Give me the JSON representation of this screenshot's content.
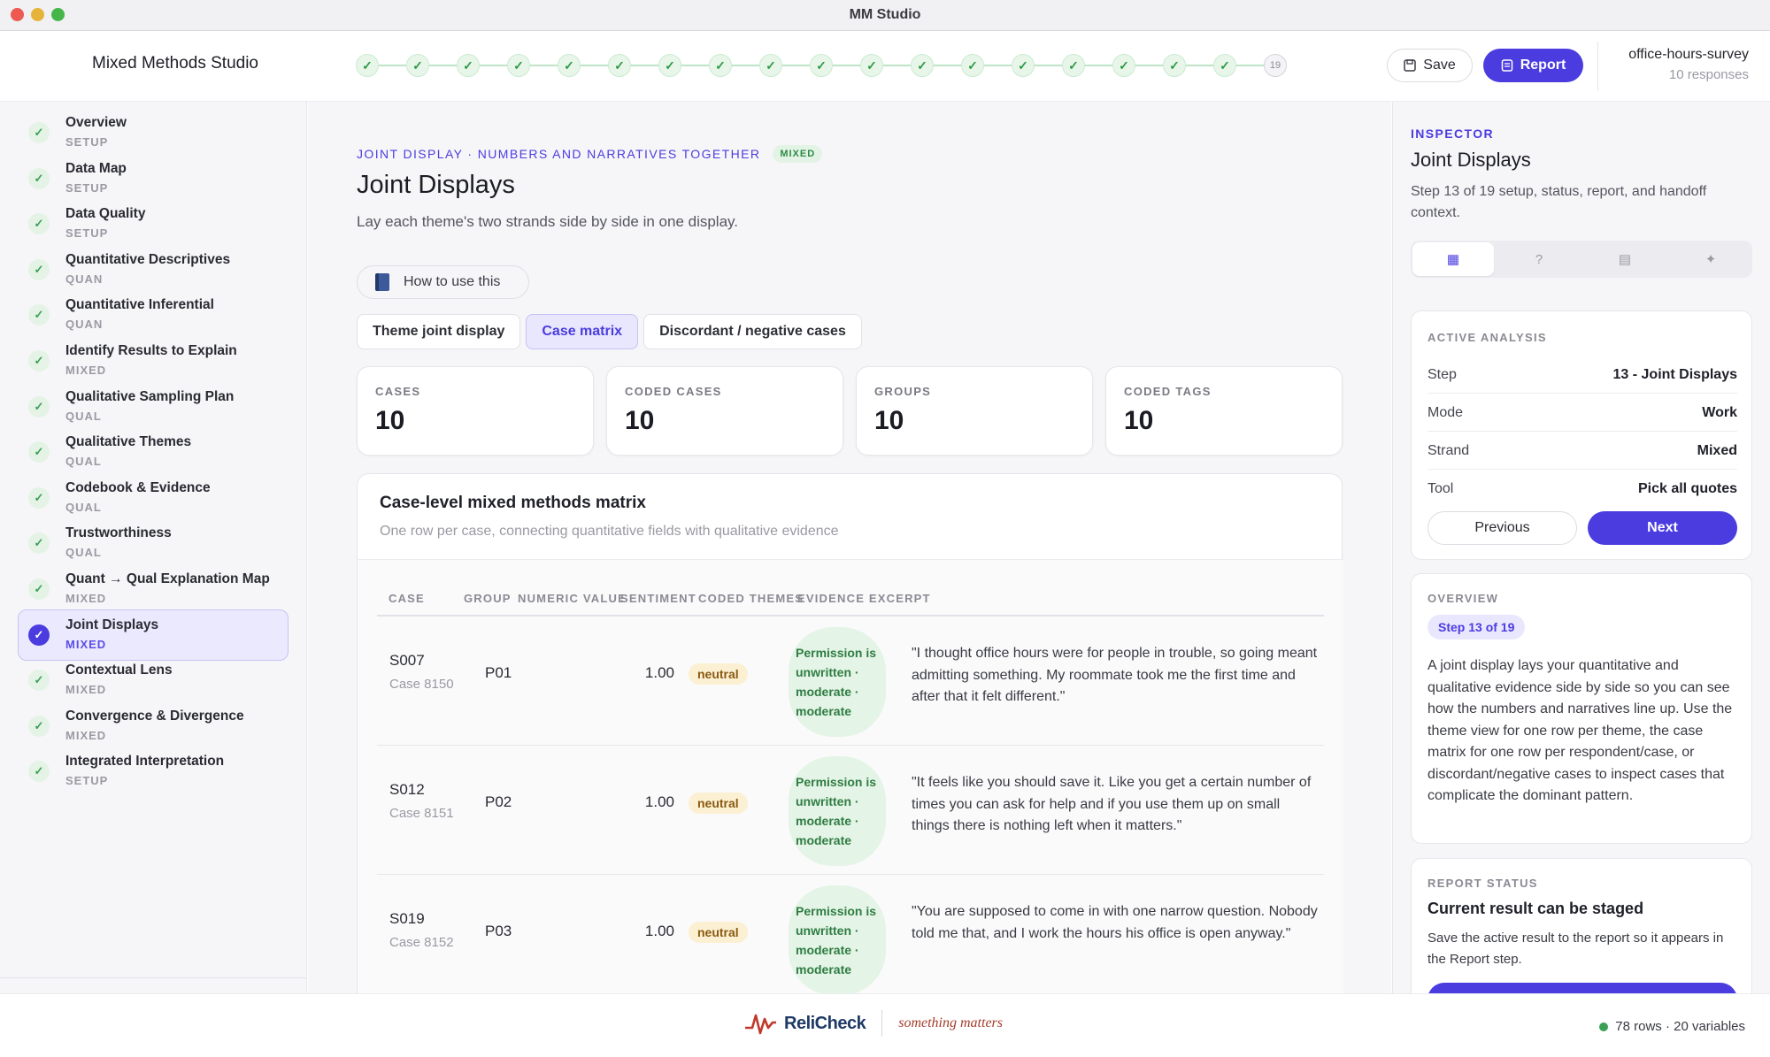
{
  "window": {
    "title": "MM Studio"
  },
  "header": {
    "brand": "Mixed Methods Studio",
    "stepper": {
      "total": 19,
      "current_label": "19",
      "completed": 18
    },
    "save_label": "Save",
    "report_label": "Report",
    "project_name": "office-hours-survey",
    "project_sub": "10 responses"
  },
  "sidebar": {
    "items": [
      {
        "label": "Overview",
        "tag": "SETUP"
      },
      {
        "label": "Data Map",
        "tag": "SETUP"
      },
      {
        "label": "Data Quality",
        "tag": "SETUP"
      },
      {
        "label": "Quantitative Descriptives",
        "tag": "QUAN"
      },
      {
        "label": "Quantitative Inferential",
        "tag": "QUAN"
      },
      {
        "label": "Identify Results to Explain",
        "tag": "MIXED"
      },
      {
        "label": "Qualitative Sampling Plan",
        "tag": "QUAL"
      },
      {
        "label": "Qualitative Themes",
        "tag": "QUAL"
      },
      {
        "label": "Codebook & Evidence",
        "tag": "QUAL"
      },
      {
        "label": "Trustworthiness",
        "tag": "QUAL"
      },
      {
        "label": "Quant → Qual Explanation Map",
        "tag": "MIXED"
      },
      {
        "label": "Joint Displays",
        "tag": "MIXED"
      },
      {
        "label": "Contextual Lens",
        "tag": "MIXED"
      },
      {
        "label": "Convergence & Divergence",
        "tag": "MIXED"
      },
      {
        "label": "Integrated Interpretation",
        "tag": "SETUP"
      }
    ],
    "active_index": 11
  },
  "main": {
    "eyebrow": "JOINT DISPLAY · NUMBERS AND NARRATIVES TOGETHER",
    "eyebrow_badge": "MIXED",
    "title": "Joint Displays",
    "description": "Lay each theme's two strands side by side in one display.",
    "howto_label": "How to use this",
    "tabs": [
      {
        "label": "Theme joint display",
        "active": false
      },
      {
        "label": "Case matrix",
        "active": true
      },
      {
        "label": "Discordant / negative cases",
        "active": false
      }
    ],
    "stats": [
      {
        "label": "CASES",
        "value": "10"
      },
      {
        "label": "CODED CASES",
        "value": "10"
      },
      {
        "label": "GROUPS",
        "value": "10"
      },
      {
        "label": "CODED TAGS",
        "value": "10"
      }
    ],
    "matrix": {
      "title": "Case-level mixed methods matrix",
      "subtitle": "One row per case, connecting quantitative fields with qualitative evidence",
      "columns": [
        "CASE",
        "GROUP",
        "NUMERIC VALUE",
        "SENTIMENT",
        "CODED THEMES",
        "EVIDENCE EXCERPT"
      ],
      "rows": [
        {
          "case": "S007",
          "case_id": "Case 8150",
          "group": "P01",
          "value": "1.00",
          "sentiment": "neutral",
          "theme": "Permission is unwritten · moderate · moderate",
          "evidence": "\"I thought office hours were for people in trouble, so going meant admitting something. My roommate took me the first time and after that it felt different.\""
        },
        {
          "case": "S012",
          "case_id": "Case 8151",
          "group": "P02",
          "value": "1.00",
          "sentiment": "neutral",
          "theme": "Permission is unwritten · moderate · moderate",
          "evidence": "\"It feels like you should save it. Like you get a certain number of times you can ask for help and if you use them up on small things there is nothing left when it matters.\""
        },
        {
          "case": "S019",
          "case_id": "Case 8152",
          "group": "P03",
          "value": "1.00",
          "sentiment": "neutral",
          "theme": "Permission is unwritten · moderate · moderate",
          "evidence": "\"You are supposed to come in with one narrow question. Nobody told me that, and I work the hours his office is open anyway.\""
        }
      ]
    }
  },
  "inspector": {
    "eyebrow": "INSPECTOR",
    "title": "Joint Displays",
    "description": "Step 13 of 19 setup, status, report, and handoff context.",
    "tabs": [
      {
        "icon": "grid-icon",
        "glyph": "▦"
      },
      {
        "icon": "help-circle-icon",
        "glyph": "?"
      },
      {
        "icon": "document-icon",
        "glyph": "▤"
      },
      {
        "icon": "sparkle-icon",
        "glyph": "✦"
      }
    ],
    "active_analysis": {
      "eyebrow": "ACTIVE ANALYSIS",
      "rows": [
        {
          "key": "Step",
          "value": "13 - Joint Displays"
        },
        {
          "key": "Mode",
          "value": "Work"
        },
        {
          "key": "Strand",
          "value": "Mixed"
        },
        {
          "key": "Tool",
          "value": "Pick all quotes"
        }
      ],
      "prev_label": "Previous",
      "next_label": "Next"
    },
    "overview": {
      "eyebrow": "OVERVIEW",
      "pill": "Step 13 of 19",
      "text": "A joint display lays your quantitative and qualitative evidence side by side so you can see how the numbers and narratives line up. Use the theme view for one row per theme, the case matrix for one row per respondent/case, or discordant/negative cases to inspect cases that complicate the dominant pattern."
    },
    "report_status": {
      "eyebrow": "REPORT STATUS",
      "title": "Current result can be staged",
      "text": "Save the active result to the report so it appears in the Report step."
    }
  },
  "footer": {
    "logo_name": "ReliCheck",
    "logo_tagline": "something matters",
    "status": "78 rows · 20 variables"
  },
  "colors": {
    "accent": "#4b3ce0",
    "success": "#3aa055",
    "neutral_badge": "#fcf0d2"
  }
}
